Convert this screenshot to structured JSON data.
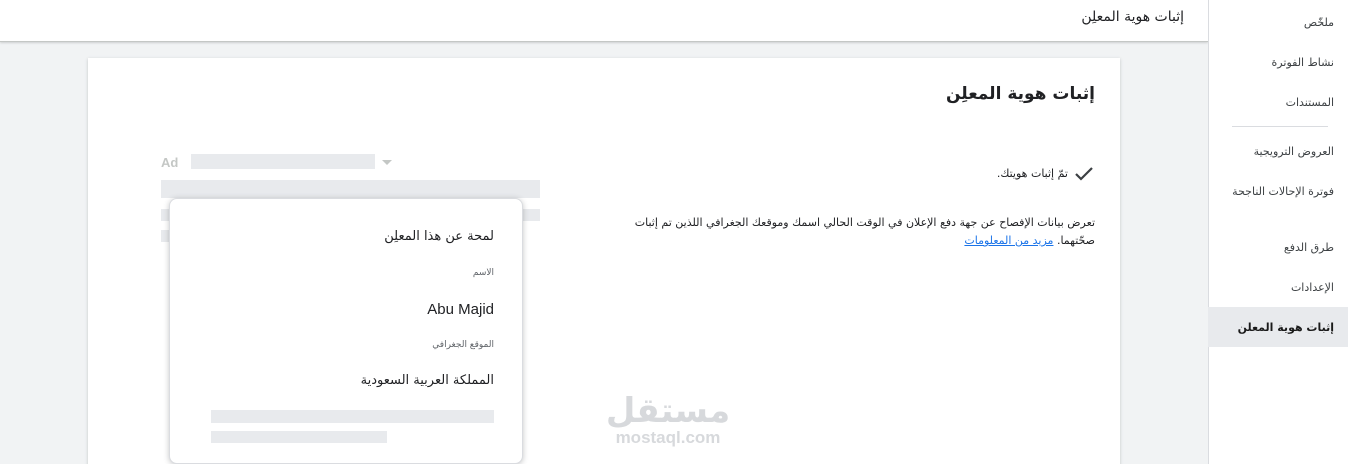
{
  "header": {
    "title": "إثبات هوية المعلِن"
  },
  "sidebar": {
    "items": [
      {
        "label": "ملخّص"
      },
      {
        "label": "نشاط الفوترة"
      },
      {
        "label": "المستندات"
      },
      {
        "label": "العروض الترويجية"
      },
      {
        "label": "فوترة الإحالات الناجحة"
      },
      {
        "label": "طرق الدفع"
      },
      {
        "label": "الإعدادات"
      },
      {
        "label": "إثبات هوية المعلن"
      }
    ],
    "active_index": 7
  },
  "card": {
    "title": "إثبات هوية المعلِن",
    "verified_status": "تمّ إثبات هويتك.",
    "description": "تعرض بيانات الإفصاح عن جهة دفع الإعلان في الوقت الحالي اسمك وموقعك الجغرافي اللذين تم إثبات صحّتهما.",
    "learn_more": "مزيد من المعلومات"
  },
  "ad_preview": {
    "ad_label": "Ad",
    "popup": {
      "heading": "لمحة عن هذا المعلِن",
      "name_label": "الاسم",
      "name_value": "Abu Majid",
      "location_label": "الموقع الجغرافي",
      "location_value": "المملكة العربية السعودية"
    }
  },
  "watermark": {
    "arabic": "مستقل",
    "latin": "mostaql.com"
  },
  "colors": {
    "link": "#1a73e8",
    "active_bg": "#e8eaed",
    "placeholder": "#e8eaed"
  }
}
